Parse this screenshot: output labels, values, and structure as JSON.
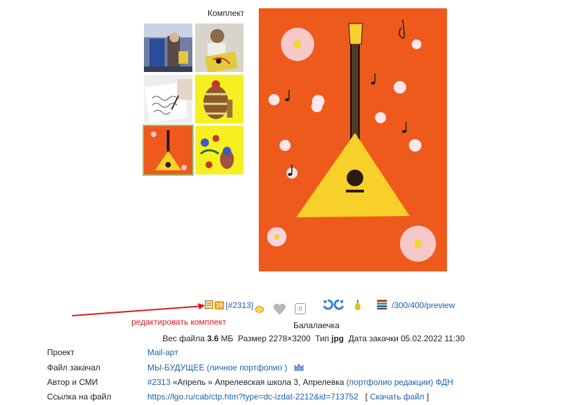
{
  "set": {
    "title": "Комплект",
    "thumbnails": [
      {
        "name": "thumb-1",
        "alt": "photo-children-at-post"
      },
      {
        "name": "thumb-2",
        "alt": "photo-child-painting"
      },
      {
        "name": "thumb-3",
        "alt": "photo-writing"
      },
      {
        "name": "thumb-4",
        "alt": "drawing-barrel"
      },
      {
        "name": "thumb-5",
        "alt": "drawing-balalaika",
        "active": true
      },
      {
        "name": "thumb-6",
        "alt": "drawing-bird-flowers"
      }
    ]
  },
  "toolbar": {
    "set_count": "19",
    "set_id": "[#2313]",
    "comment_count": "0",
    "preview_path": "/300/400/preview"
  },
  "annotation": {
    "text": "редактировать комплект",
    "color": "#e0161c"
  },
  "item": {
    "title": "Балалаечка"
  },
  "file_info": {
    "size_label": "Вес файла",
    "size_value": "3.6",
    "size_unit": "МБ",
    "dim_label": "Размер",
    "dim_value": "2278×3200",
    "type_label": "Тип",
    "type_value": "jpg",
    "date_label": "Дата закачки",
    "date_value": "05.02.2022 11:30"
  },
  "details": {
    "project_label": "Проект",
    "project_value": "Mail-арт",
    "uploader_label": "Файл закачал",
    "uploader_value": "МЫ-БУДУЩЕЕ",
    "uploader_open": "(",
    "uploader_portfolio": "личное портфолио",
    "uploader_close": ")",
    "author_label": "Автор и СМИ",
    "author_id": "#2313",
    "author_text": "«Апрель » Апрелевская школа 3, Апрелевка",
    "author_open": "(",
    "author_portfolio": "портфолио редакции",
    "author_close": ")",
    "author_fdn": "ФДН",
    "link_label": "Ссылка на файл",
    "link_value": "https://lgo.ru/cab/ctp.htm?type=dc-izdat-2212&id=713752",
    "download_open": "[",
    "download_label": "Скачать файл",
    "download_close": "]"
  },
  "colors": {
    "link": "#1a5fb4",
    "accent_orange": "#f39c12",
    "painting_bg": "#ee5a1c",
    "balalaika_body": "#f7d02a"
  }
}
